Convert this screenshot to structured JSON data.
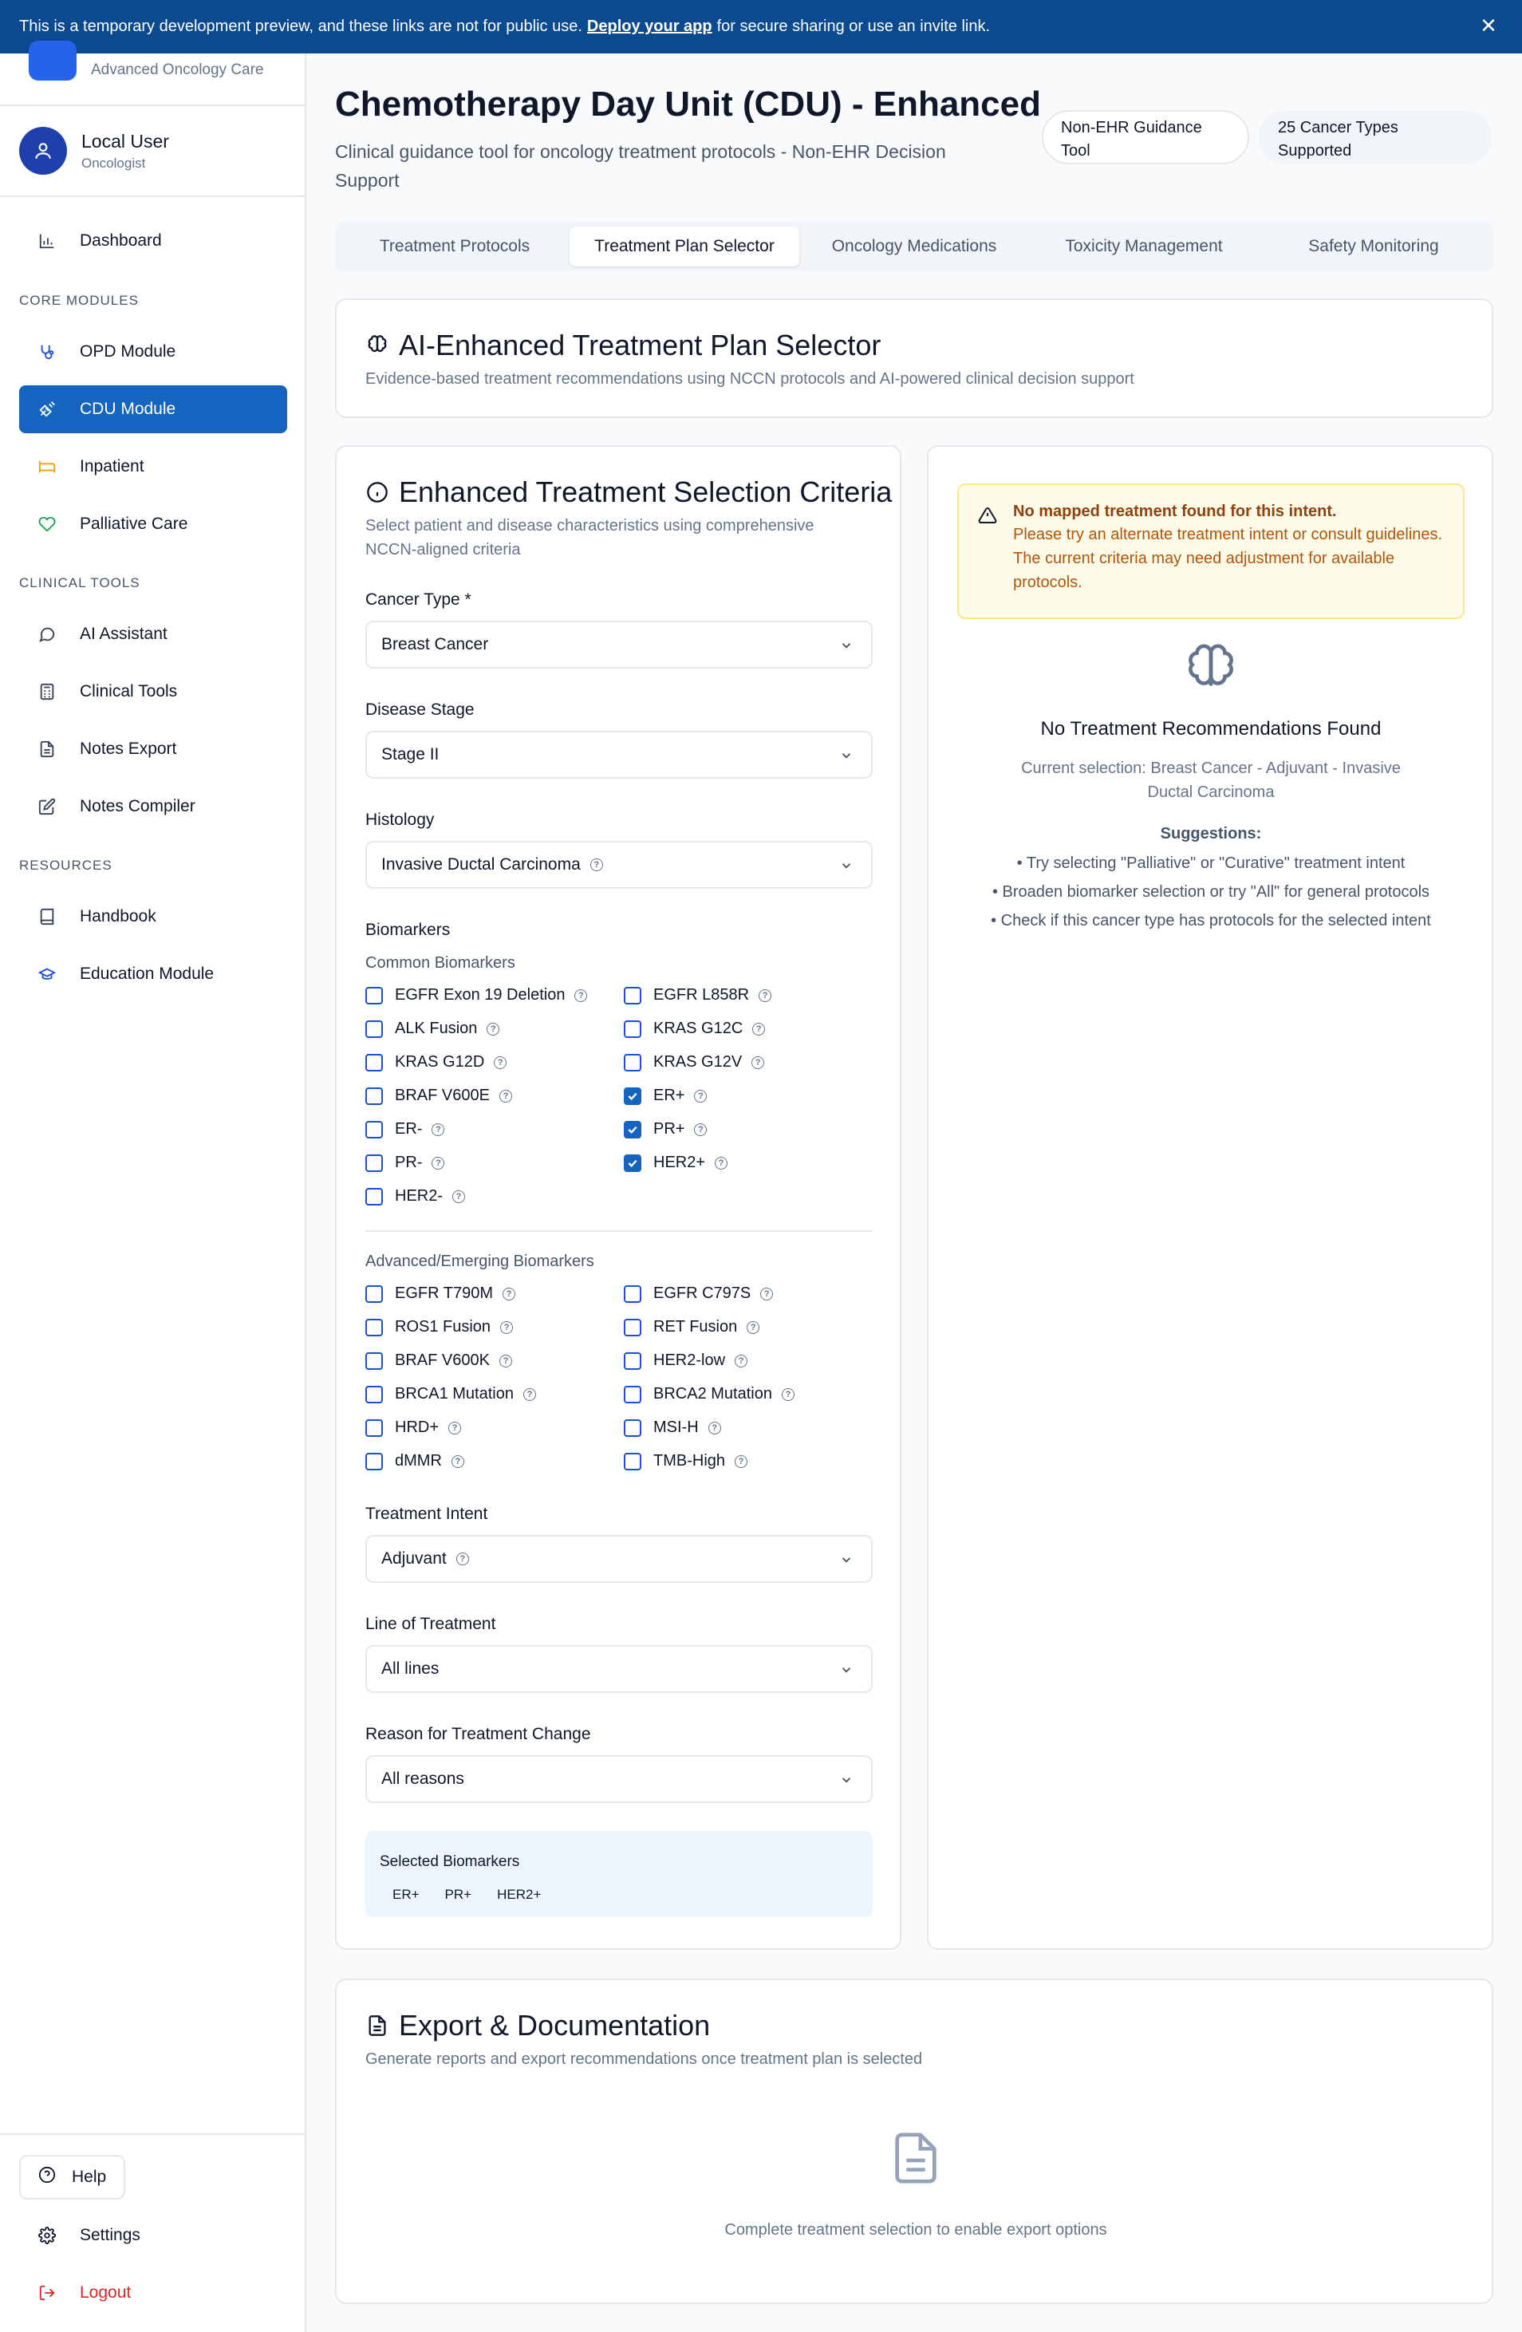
{
  "banner": {
    "text_before": "This is a temporary development preview, and these links are not for public use.",
    "link": "Deploy your app",
    "text_after": "for secure sharing or use an invite link.",
    "close": "✕"
  },
  "sidebar": {
    "brand_subtitle": "Advanced Oncology Care",
    "user": {
      "name": "Local User",
      "role": "Oncologist"
    },
    "dashboard": "Dashboard",
    "section_core": "CORE MODULES",
    "core": [
      {
        "label": "OPD Module",
        "icon": "stethoscope-icon"
      },
      {
        "label": "CDU Module",
        "icon": "syringe-icon"
      },
      {
        "label": "Inpatient",
        "icon": "bed-icon"
      },
      {
        "label": "Palliative Care",
        "icon": "heart-icon"
      }
    ],
    "section_clinical": "CLINICAL TOOLS",
    "clinical": [
      {
        "label": "AI Assistant",
        "icon": "chat-icon"
      },
      {
        "label": "Clinical Tools",
        "icon": "calculator-icon"
      },
      {
        "label": "Notes Export",
        "icon": "file-icon"
      },
      {
        "label": "Notes Compiler",
        "icon": "edit-icon"
      }
    ],
    "section_resources": "RESOURCES",
    "resources": [
      {
        "label": "Handbook",
        "icon": "book-icon"
      },
      {
        "label": "Education Module",
        "icon": "graduation-cap-icon"
      }
    ],
    "help": "Help",
    "settings": "Settings",
    "logout": "Logout"
  },
  "header": {
    "title": "Chemotherapy Day Unit (CDU) - Enhanced",
    "subtitle": "Clinical guidance tool for oncology treatment protocols - Non-EHR Decision Support",
    "badge1": "Non-EHR Guidance Tool",
    "badge2": "25 Cancer Types Supported"
  },
  "tabs": [
    "Treatment Protocols",
    "Treatment Plan Selector",
    "Oncology Medications",
    "Toxicity Management",
    "Safety Monitoring"
  ],
  "ai_card": {
    "title": "AI-Enhanced Treatment Plan Selector",
    "desc": "Evidence-based treatment recommendations using NCCN protocols and AI-powered clinical decision support"
  },
  "criteria": {
    "title": "Enhanced Treatment Selection Criteria",
    "desc": "Select patient and disease characteristics using comprehensive NCCN-aligned criteria",
    "cancer_type_label": "Cancer Type *",
    "cancer_type": "Breast Cancer",
    "stage_label": "Disease Stage",
    "stage": "Stage II",
    "histology_label": "Histology",
    "histology": "Invasive Ductal Carcinoma",
    "biomarkers_label": "Biomarkers",
    "common_label": "Common Biomarkers",
    "common": [
      {
        "label": "EGFR Exon 19 Deletion",
        "checked": false
      },
      {
        "label": "EGFR L858R",
        "checked": false
      },
      {
        "label": "ALK Fusion",
        "checked": false
      },
      {
        "label": "KRAS G12C",
        "checked": false
      },
      {
        "label": "KRAS G12D",
        "checked": false
      },
      {
        "label": "KRAS G12V",
        "checked": false
      },
      {
        "label": "BRAF V600E",
        "checked": false
      },
      {
        "label": "ER+",
        "checked": true
      },
      {
        "label": "ER-",
        "checked": false
      },
      {
        "label": "PR+",
        "checked": true
      },
      {
        "label": "PR-",
        "checked": false
      },
      {
        "label": "HER2+",
        "checked": true
      },
      {
        "label": "HER2-",
        "checked": false
      }
    ],
    "advanced_label": "Advanced/Emerging Biomarkers",
    "advanced": [
      {
        "label": "EGFR T790M",
        "checked": false
      },
      {
        "label": "EGFR C797S",
        "checked": false
      },
      {
        "label": "ROS1 Fusion",
        "checked": false
      },
      {
        "label": "RET Fusion",
        "checked": false
      },
      {
        "label": "BRAF V600K",
        "checked": false
      },
      {
        "label": "HER2-low",
        "checked": false
      },
      {
        "label": "BRCA1 Mutation",
        "checked": false
      },
      {
        "label": "BRCA2 Mutation",
        "checked": false
      },
      {
        "label": "HRD+",
        "checked": false
      },
      {
        "label": "MSI-H",
        "checked": false
      },
      {
        "label": "dMMR",
        "checked": false
      },
      {
        "label": "TMB-High",
        "checked": false
      }
    ],
    "intent_label": "Treatment Intent",
    "intent": "Adjuvant",
    "line_label": "Line of Treatment",
    "line": "All lines",
    "reason_label": "Reason for Treatment Change",
    "reason": "All reasons",
    "selected_title": "Selected Biomarkers",
    "selected": [
      "ER+",
      "PR+",
      "HER2+"
    ]
  },
  "results": {
    "alert_title": "No mapped treatment found for this intent.",
    "alert_body": "Please try an alternate treatment intent or consult guidelines. The current criteria may need adjustment for available protocols.",
    "none_title": "No Treatment Recommendations Found",
    "current": "Current selection: Breast Cancer - Adjuvant - Invasive Ductal Carcinoma",
    "sugg_title": "Suggestions:",
    "suggestions": [
      "• Try selecting \"Palliative\" or \"Curative\" treatment intent",
      "• Broaden biomarker selection or try \"All\" for general protocols",
      "• Check if this cancer type has protocols for the selected intent"
    ]
  },
  "export": {
    "title": "Export & Documentation",
    "desc": "Generate reports and export recommendations once treatment plan is selected",
    "empty": "Complete treatment selection to enable export options"
  },
  "colors": {
    "primary": "#1565c0",
    "banner": "#0b4a8f",
    "warning_bg": "#fefce8",
    "warning_text": "#92400e",
    "danger": "#dc2626"
  }
}
